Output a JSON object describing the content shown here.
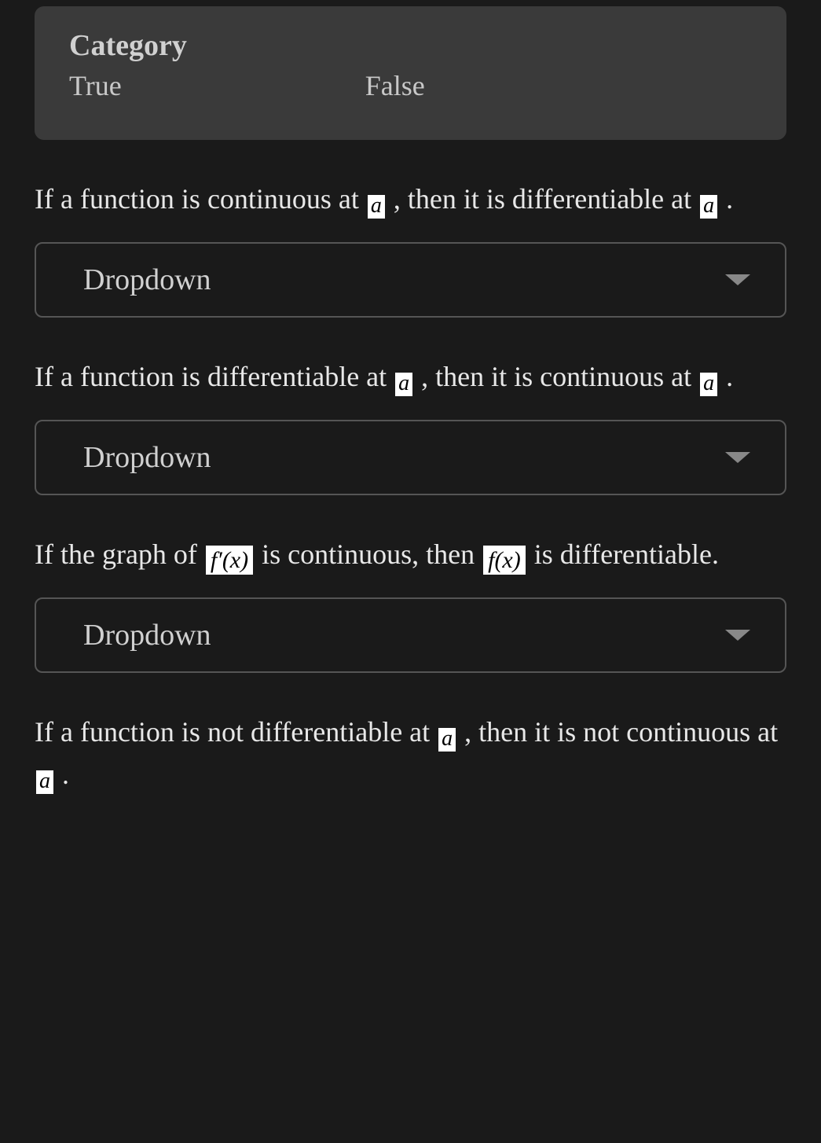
{
  "category": {
    "title": "Category",
    "options": [
      "True",
      "False"
    ]
  },
  "dropdown_label": "Dropdown",
  "questions": [
    {
      "parts": [
        {
          "type": "text",
          "value": "If a function is continuous at "
        },
        {
          "type": "math_var",
          "value": "a"
        },
        {
          "type": "text",
          "value": " , then it is differentiable at "
        },
        {
          "type": "math_var",
          "value": "a"
        },
        {
          "type": "text",
          "value": " ."
        }
      ]
    },
    {
      "parts": [
        {
          "type": "text",
          "value": "If a function is differentiable at "
        },
        {
          "type": "math_var",
          "value": "a"
        },
        {
          "type": "text",
          "value": " , then it is continuous at "
        },
        {
          "type": "math_var",
          "value": "a"
        },
        {
          "type": "text",
          "value": " ."
        }
      ]
    },
    {
      "parts": [
        {
          "type": "text",
          "value": "If the graph of "
        },
        {
          "type": "math_expr",
          "value": "f′(x)"
        },
        {
          "type": "text",
          "value": " is continuous, then "
        },
        {
          "type": "math_expr",
          "value": "f(x)"
        },
        {
          "type": "text",
          "value": " is differentiable."
        }
      ]
    },
    {
      "parts": [
        {
          "type": "text",
          "value": "If a function is not differentiable at "
        },
        {
          "type": "math_var",
          "value": "a"
        },
        {
          "type": "text",
          "value": " , then it is not continuous at "
        },
        {
          "type": "math_var",
          "value": "a"
        },
        {
          "type": "text",
          "value": " ."
        }
      ]
    }
  ]
}
